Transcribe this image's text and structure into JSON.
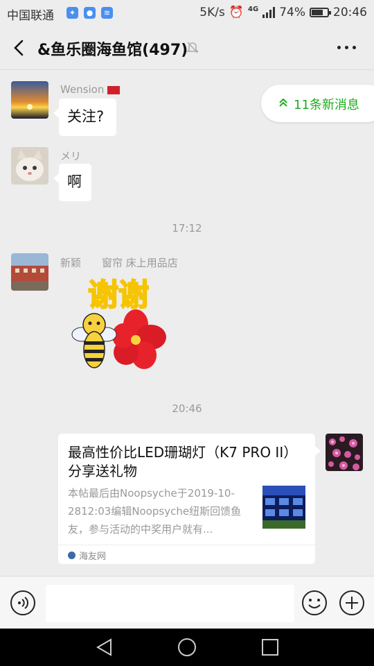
{
  "status": {
    "carrier": "中国联通",
    "speed": "5K/s",
    "network": "4G",
    "battery": "74%",
    "battery_level": 0.74,
    "time": "20:46"
  },
  "header": {
    "title": "&鱼乐圈海鱼馆(497)"
  },
  "new_messages": {
    "label": "11条新消息"
  },
  "messages": [
    {
      "sender": "Wension",
      "text": "关注?"
    },
    {
      "sender": "メリ",
      "text": "啊"
    },
    {
      "sender": "新颖　　窗帘  床上用品店",
      "sticker_text": "谢谢"
    }
  ],
  "times": [
    "17:12",
    "20:46"
  ],
  "card": {
    "title": "最高性价比LED珊瑚灯（K7 PRO II）分享送礼物",
    "desc": "本帖最后由Noopsyche于2019-10-2812:03编辑Noopsyche纽斯回馈鱼友，参与活动的中奖用户就有...",
    "source": "海友网"
  },
  "input": {
    "placeholder": ""
  },
  "icons": [
    "back-icon",
    "mute-icon",
    "more-icon",
    "voice-icon",
    "emoji-icon",
    "plus-icon",
    "nav-back-icon",
    "nav-home-icon",
    "nav-recent-icon"
  ]
}
